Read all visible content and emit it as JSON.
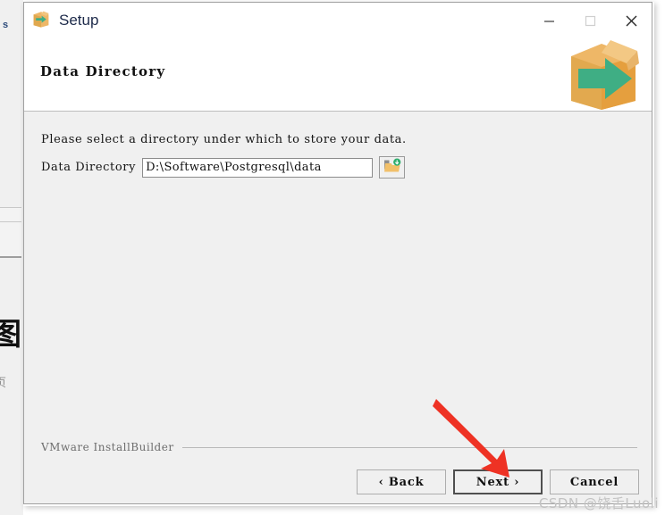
{
  "window": {
    "title": "Setup",
    "app_icon": "install-box-arrow-icon",
    "controls": {
      "minimize": "minimize-icon",
      "maximize": "maximize-icon",
      "close": "close-icon"
    }
  },
  "header": {
    "page_title": "Data Directory",
    "logo": "installbuilder-box-arrow-logo",
    "logo_box_color": "#eeb767",
    "logo_arrow_color": "#3fae84"
  },
  "content": {
    "instruction": "Please select a directory under which to store your data.",
    "field_label": "Data Directory",
    "field_value": "D:\\Software\\Postgresql\\data",
    "field_placeholder": "",
    "browse_icon": "open-folder-icon"
  },
  "footer": {
    "brand": "VMware InstallBuilder",
    "buttons": {
      "back": "‹ Back",
      "next": "Next ›",
      "cancel": "Cancel"
    },
    "default_button": "next"
  },
  "annotation": {
    "arrow_color": "#ee3224",
    "points_at": "next-button"
  },
  "watermark": {
    "text": "CSDN @饶舌Luoli"
  },
  "background": {
    "tab_fragment": "s",
    "cjk_large_fragment": "图",
    "cjk_small_fragment": "页"
  }
}
